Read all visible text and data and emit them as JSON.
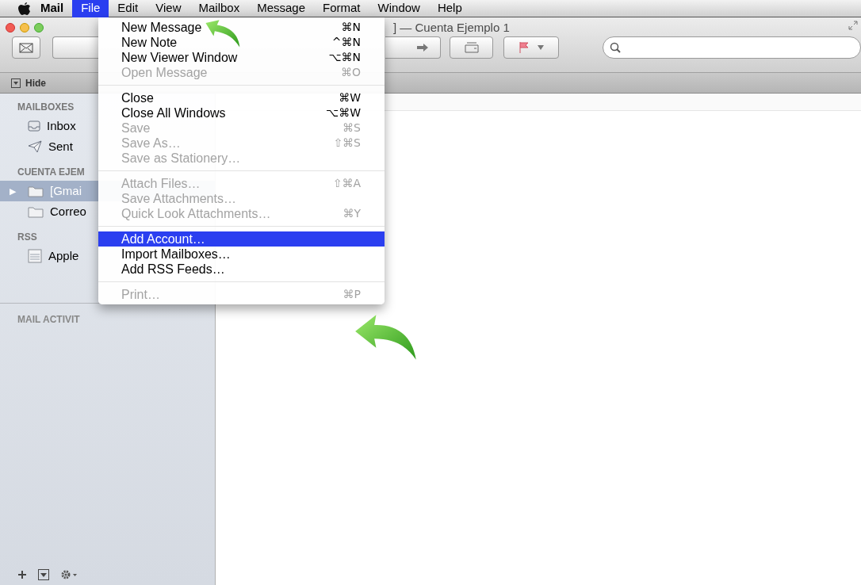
{
  "menu_bar": [
    {
      "label": "Mail",
      "selected": false,
      "kind": "app"
    },
    {
      "label": "File",
      "selected": true,
      "kind": "menu"
    },
    {
      "label": "Edit",
      "selected": false,
      "kind": "menu"
    },
    {
      "label": "View",
      "selected": false,
      "kind": "menu"
    },
    {
      "label": "Mailbox",
      "selected": false,
      "kind": "menu"
    },
    {
      "label": "Message",
      "selected": false,
      "kind": "menu"
    },
    {
      "label": "Format",
      "selected": false,
      "kind": "menu"
    },
    {
      "label": "Window",
      "selected": false,
      "kind": "menu"
    },
    {
      "label": "Help",
      "selected": false,
      "kind": "menu"
    }
  ],
  "window": {
    "title": "] — Cuenta Ejemplo 1",
    "hide_label": "Hide"
  },
  "sidebar": {
    "sections": [
      {
        "heading": "MAILBOXES",
        "items": [
          {
            "label": "Inbox",
            "kind": "inbox",
            "selected": false
          },
          {
            "label": "Sent",
            "kind": "sent",
            "selected": false
          }
        ]
      },
      {
        "heading": "CUENTA EJEM",
        "items": [
          {
            "label": "[Gmai",
            "kind": "folder",
            "selected": true,
            "toggle": "▶"
          },
          {
            "label": "Correo",
            "kind": "folder",
            "selected": false
          }
        ]
      },
      {
        "heading": "RSS",
        "items": [
          {
            "label": "Apple",
            "kind": "rss",
            "selected": false
          }
        ]
      }
    ],
    "activity_heading": "MAIL ACTIVIT"
  },
  "file_menu": [
    {
      "kind": "item",
      "label": "New Message",
      "shortcut": "⌘N",
      "disabled": false,
      "selected": false
    },
    {
      "kind": "item",
      "label": "New Note",
      "shortcut": "^⌘N",
      "disabled": false,
      "selected": false
    },
    {
      "kind": "item",
      "label": "New Viewer Window",
      "shortcut": "⌥⌘N",
      "disabled": false,
      "selected": false
    },
    {
      "kind": "item",
      "label": "Open Message",
      "shortcut": "⌘O",
      "disabled": true,
      "selected": false
    },
    {
      "kind": "separator"
    },
    {
      "kind": "item",
      "label": "Close",
      "shortcut": "⌘W",
      "disabled": false,
      "selected": false
    },
    {
      "kind": "item",
      "label": "Close All Windows",
      "shortcut": "⌥⌘W",
      "disabled": false,
      "selected": false
    },
    {
      "kind": "item",
      "label": "Save",
      "shortcut": "⌘S",
      "disabled": true,
      "selected": false
    },
    {
      "kind": "item",
      "label": "Save As…",
      "shortcut": "⇧⌘S",
      "disabled": true,
      "selected": false
    },
    {
      "kind": "item",
      "label": "Save as Stationery…",
      "disabled": true,
      "selected": false
    },
    {
      "kind": "separator"
    },
    {
      "kind": "item",
      "label": "Attach Files…",
      "shortcut": "⇧⌘A",
      "disabled": true,
      "selected": false
    },
    {
      "kind": "item",
      "label": "Save Attachments…",
      "disabled": true,
      "selected": false
    },
    {
      "kind": "item",
      "label": "Quick Look Attachments…",
      "shortcut": "⌘Y",
      "disabled": true,
      "selected": false
    },
    {
      "kind": "separator"
    },
    {
      "kind": "item",
      "label": "Add Account…",
      "disabled": false,
      "selected": true
    },
    {
      "kind": "item",
      "label": "Import Mailboxes…",
      "disabled": false,
      "selected": false
    },
    {
      "kind": "item",
      "label": "Add RSS Feeds…",
      "disabled": false,
      "selected": false
    },
    {
      "kind": "separator"
    },
    {
      "kind": "item",
      "label": "Print…",
      "shortcut": "⌘P",
      "disabled": true,
      "selected": false
    }
  ]
}
